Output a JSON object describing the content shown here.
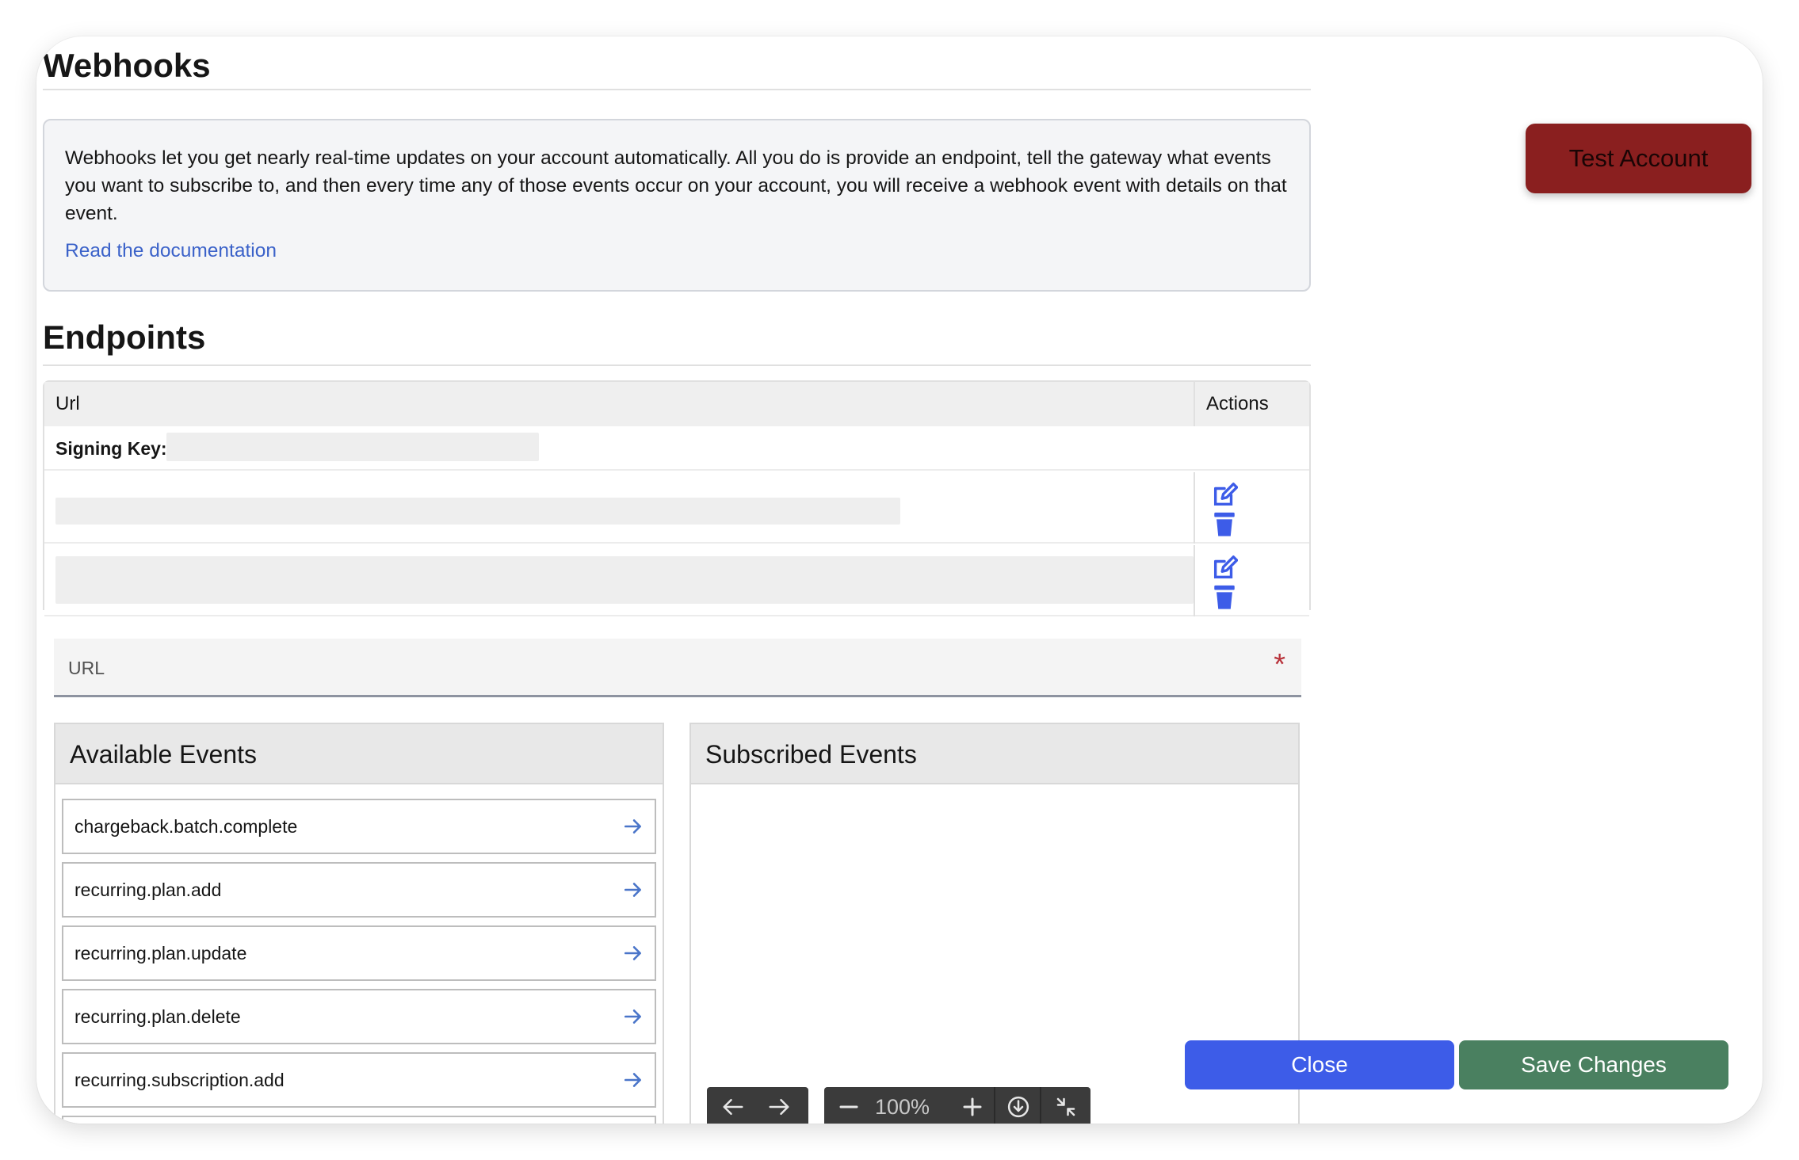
{
  "page": {
    "title": "Webhooks",
    "info_text": "Webhooks let you get nearly real-time updates on your account automatically. All you do is provide an endpoint, tell the gateway what events you want to subscribe to, and then every time any of those events occur on your account, you will receive a webhook event with details on that event.",
    "doc_link": "Read the documentation",
    "test_account_label": "Test Account"
  },
  "endpoints": {
    "title": "Endpoints",
    "col_url": "Url",
    "col_actions": "Actions",
    "signing_key_label": "Signing Key:",
    "rows": [
      {
        "edit_icon": "edit-icon",
        "delete_icon": "trash-icon"
      },
      {
        "edit_icon": "edit-icon",
        "delete_icon": "trash-icon"
      }
    ]
  },
  "form": {
    "url_placeholder": "URL",
    "required_marker": "*",
    "available_title": "Available Events",
    "subscribed_title": "Subscribed Events",
    "available_events": [
      "chargeback.batch.complete",
      "recurring.plan.add",
      "recurring.plan.update",
      "recurring.plan.delete",
      "recurring.subscription.add"
    ],
    "subscribed_events": []
  },
  "footer": {
    "close_label": "Close",
    "save_label": "Save Changes"
  },
  "viewer": {
    "zoom": "100%"
  },
  "colors": {
    "test_account": "#8a1f1f",
    "close": "#3d5ce8",
    "save": "#4a8060",
    "link": "#3b62c9",
    "icon": "#3d5ce8"
  }
}
